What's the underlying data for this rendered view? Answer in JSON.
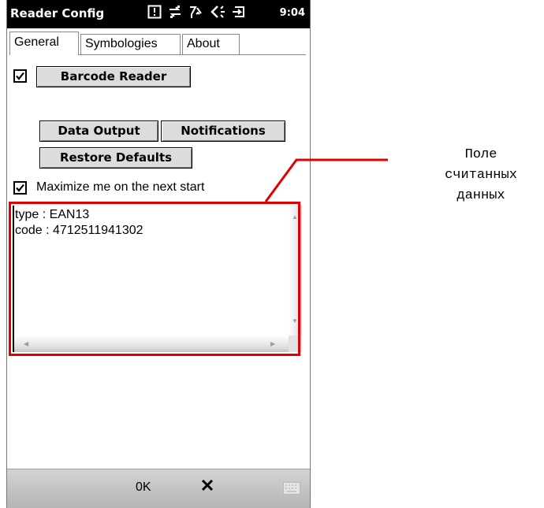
{
  "window": {
    "title": "Reader Config",
    "time": "9:04"
  },
  "status_icons": [
    "notification-icon",
    "sync-icon",
    "signal-icon",
    "volume-icon",
    "battery-icon"
  ],
  "tabs": [
    {
      "label": "General",
      "active": true
    },
    {
      "label": "Symbologies",
      "active": false
    },
    {
      "label": "About",
      "active": false
    }
  ],
  "general": {
    "barcode_reader": {
      "checked": true,
      "label": "Barcode Reader"
    },
    "buttons": {
      "data_output": "Data Output",
      "notifications": "Notifications",
      "restore_defaults": "Restore Defaults"
    },
    "maximize": {
      "checked": true,
      "label": "Maximize me on the next start"
    }
  },
  "scanned_data": {
    "lines": [
      "type : EAN13",
      "code : 4712511941302"
    ]
  },
  "softkeys": {
    "ok": "0K",
    "close_icon": "close-icon",
    "keyboard_icon": "keyboard-icon"
  },
  "annotation": {
    "lines": [
      "Поле",
      "считанных",
      "данных"
    ],
    "color": "#e00000"
  }
}
